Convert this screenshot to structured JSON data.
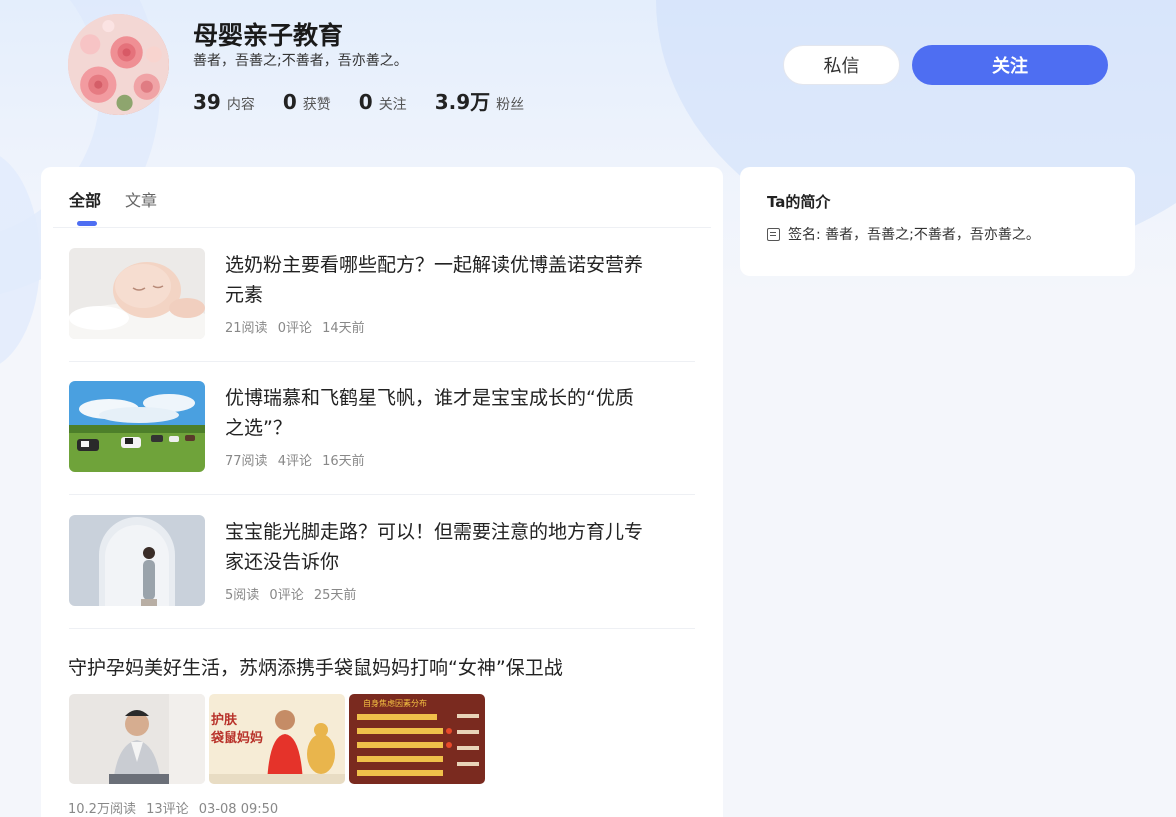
{
  "profile": {
    "name": "母婴亲子教育",
    "motto": "善者，吾善之;不善者，吾亦善之。",
    "stats": [
      {
        "num": "39",
        "label": "内容"
      },
      {
        "num": "0",
        "label": "获赞"
      },
      {
        "num": "0",
        "label": "关注"
      },
      {
        "num": "3.9万",
        "label": "粉丝"
      }
    ]
  },
  "actions": {
    "message": "私信",
    "follow": "关注"
  },
  "tabs": [
    {
      "label": "全部",
      "active": true
    },
    {
      "label": "文章",
      "active": false
    }
  ],
  "articles": [
    {
      "title": "选奶粉主要看哪些配方？一起解读优博盖诺安营养元素",
      "reads": "21阅读",
      "comments": "0评论",
      "time": "14天前",
      "thumb": "sleeping-baby"
    },
    {
      "title": "优博瑞慕和飞鹤星飞帆，谁才是宝宝成长的“优质之选”？",
      "reads": "77阅读",
      "comments": "4评论",
      "time": "16天前",
      "thumb": "cows-on-pasture"
    },
    {
      "title": "宝宝能光脚走路？可以！但需要注意的地方育儿专家还没告诉你",
      "reads": "5阅读",
      "comments": "0评论",
      "time": "25天前",
      "thumb": "woman-in-arch"
    }
  ],
  "article_multi": {
    "title": "守护孕妈美好生活，苏炳添携手袋鼠妈妈打响“女神”保卫战",
    "reads": "10.2万阅读",
    "comments": "13评论",
    "time": "03-08 09:50",
    "pics": [
      "man-portrait",
      "kangaroo-mama-ad",
      "infographic"
    ],
    "ad_text_1": "护肤",
    "ad_text_2": "袋鼠妈妈",
    "infographic_title": "自身焦虑因素分布"
  },
  "intro": {
    "title": "Ta的简介",
    "signature": "签名: 善者，吾善之;不善者，吾亦善之。"
  },
  "colors": {
    "accent": "#4e6ef2",
    "background": "#f4f6fb"
  }
}
